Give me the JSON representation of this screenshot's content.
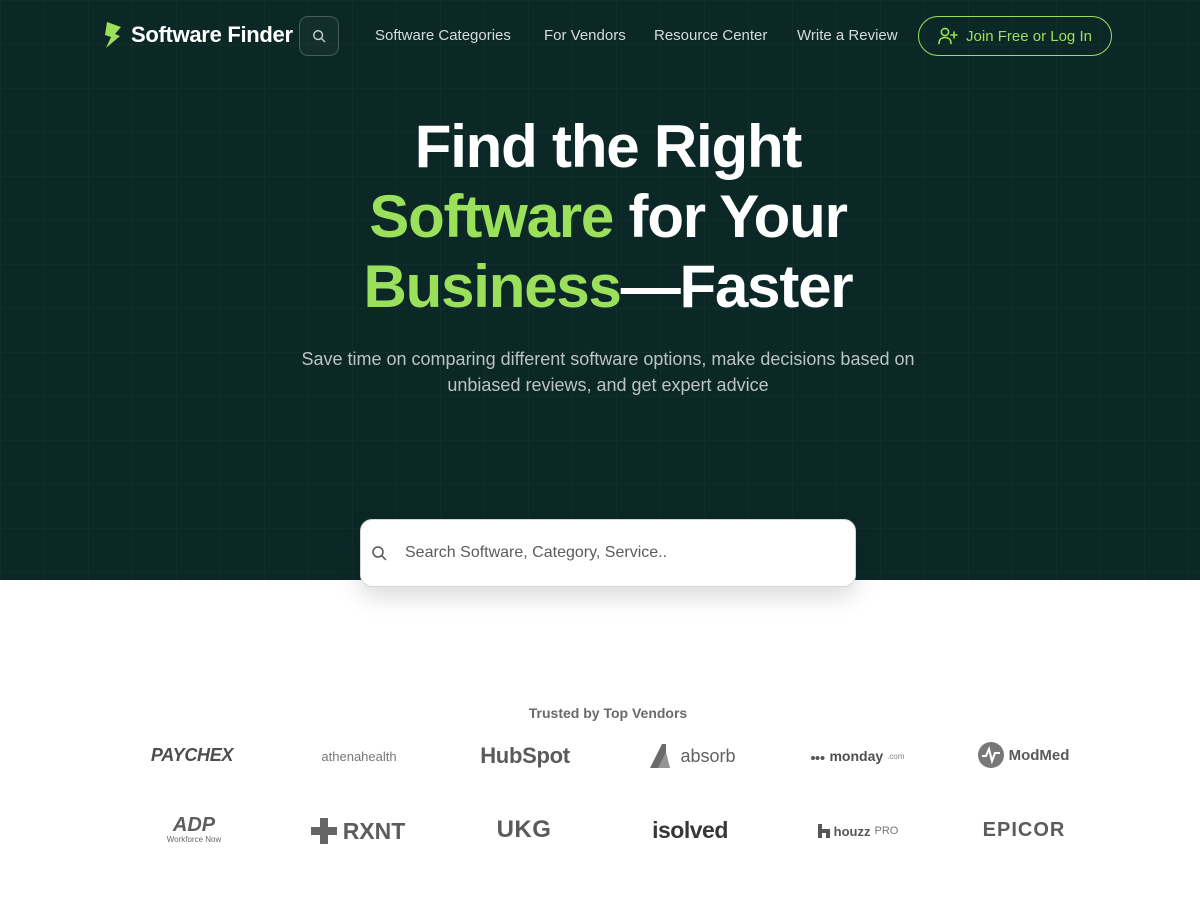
{
  "nav": {
    "logo_text": "Software Finder",
    "links": [
      {
        "label": "Software Categories"
      },
      {
        "label": "For Vendors"
      },
      {
        "label": "Resource Center"
      },
      {
        "label": "Write a Review"
      }
    ],
    "join_label": "Join Free or Log In"
  },
  "hero": {
    "line1": "Find the Right",
    "line2_accent": "Software",
    "line2_rest": " for Your",
    "line3_accent": "Business",
    "line3_rest": "—Faster",
    "subtitle": "Save time on comparing different software options, make decisions based on unbiased reviews, and get expert advice"
  },
  "search": {
    "placeholder": "Search Software, Category, Service.."
  },
  "trusted": {
    "title": "Trusted by Top Vendors",
    "logos": [
      {
        "name": "PAYCHEX"
      },
      {
        "name": "athenahealth"
      },
      {
        "name": "HubSpot"
      },
      {
        "name": "absorb"
      },
      {
        "name": "monday",
        "suffix": ".com"
      },
      {
        "name": "ModMed"
      },
      {
        "name": "ADP",
        "caption": "Workforce Now"
      },
      {
        "name": "RXNT"
      },
      {
        "name": "UKG"
      },
      {
        "name": "isolved"
      },
      {
        "name": "houzz",
        "suffix": "PRO"
      },
      {
        "name": "EPICOR"
      }
    ]
  },
  "colors": {
    "hero_bg": "#0b2827",
    "accent": "#9be05a"
  }
}
